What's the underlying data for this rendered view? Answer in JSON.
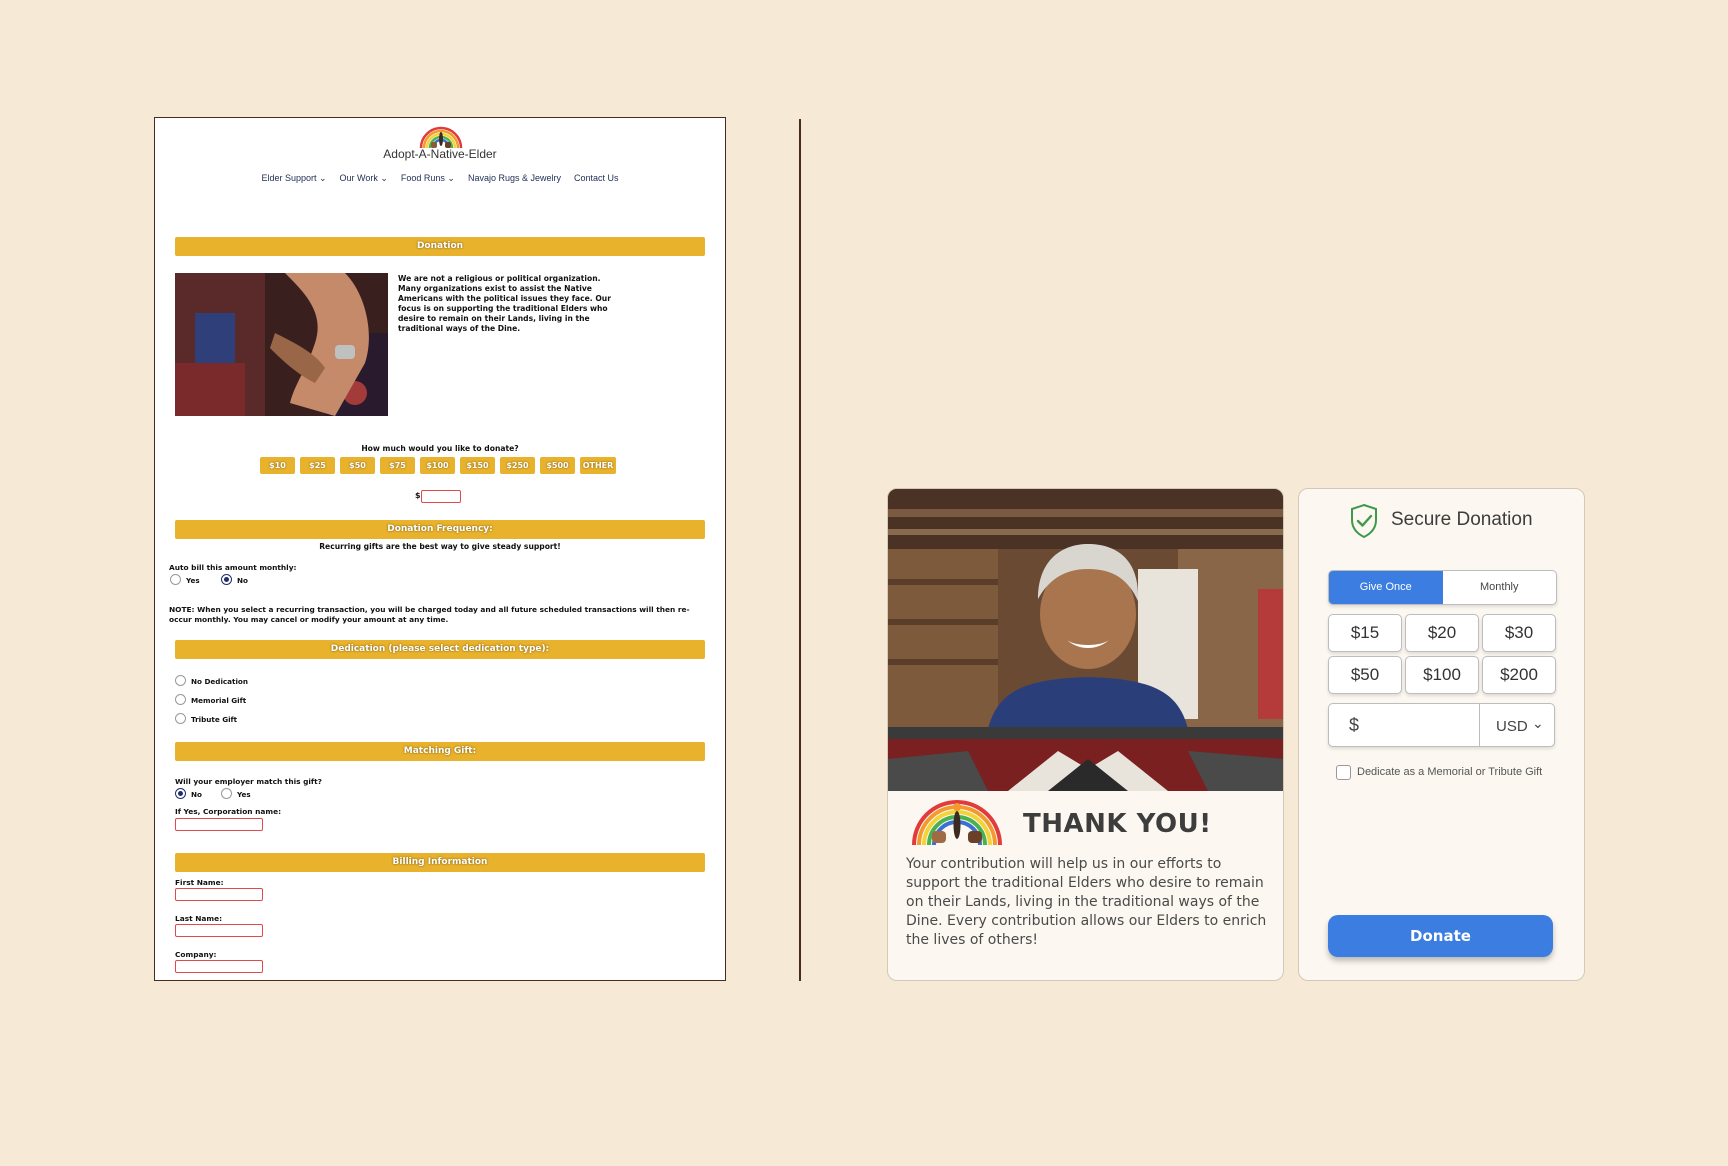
{
  "old_page": {
    "brand": "Adopt-A-Native-Elder",
    "nav": [
      "Elder Support ⌄",
      "Our Work ⌄",
      "Food Runs ⌄",
      "Navajo Rugs & Jewelry",
      "Contact Us"
    ],
    "sections": {
      "donation": "Donation",
      "frequency": "Donation Frequency:",
      "dedication": "Dedication (please select dedication type):",
      "matching": "Matching Gift:",
      "billing": "Billing Information"
    },
    "intro": "We are not a religious or political organization. Many organizations exist to assist the Native Americans with the political issues they face. Our focus is on supporting the traditional Elders who desire to remain on their Lands, living in the traditional ways of the Dine.",
    "amount_question": "How much would you like to donate?",
    "amounts": [
      "$10",
      "$25",
      "$50",
      "$75",
      "$100",
      "$150",
      "$250",
      "$500",
      "OTHER"
    ],
    "dollar_sign": "$",
    "recurring_text": "Recurring gifts are the best way to give steady support!",
    "auto_bill_label": "Auto bill this amount monthly:",
    "auto_bill_yes": "Yes",
    "auto_bill_no": "No",
    "note": "NOTE: When you select a recurring transaction, you will be charged today and all future scheduled transactions will then re-occur monthly. You may cancel or modify your amount at any time.",
    "dedication_options": [
      "No Dedication",
      "Memorial Gift",
      "Tribute Gift"
    ],
    "match_question": "Will your employer match this gift?",
    "match_no": "No",
    "match_yes": "Yes",
    "corp_label": "If Yes, Corporation name:",
    "first_name_label": "First Name:",
    "last_name_label": "Last Name:",
    "company_label": "Company:"
  },
  "thank_card": {
    "title": "THANK YOU!",
    "body": "Your contribution will help us in our efforts to support the traditional Elders who desire to remain on their Lands, living in the traditional ways of the Dine. Every contribution allows our Elders to enrich the lives of others!"
  },
  "donation_card": {
    "title": "Secure Donation",
    "tabs": [
      "Give Once",
      "Monthly"
    ],
    "active_tab": "Give Once",
    "amounts": [
      "$15",
      "$20",
      "$30",
      "$50",
      "$100",
      "$200"
    ],
    "currency_symbol": "$",
    "currency": "USD",
    "dedicate_label": "Dedicate as a Memorial or Tribute Gift",
    "donate_label": "Donate",
    "accent_color": "#3b7de0"
  },
  "colors": {
    "background": "#f6e9d6",
    "section_bar": "#e9b22c",
    "accent": "#3b7de0"
  }
}
